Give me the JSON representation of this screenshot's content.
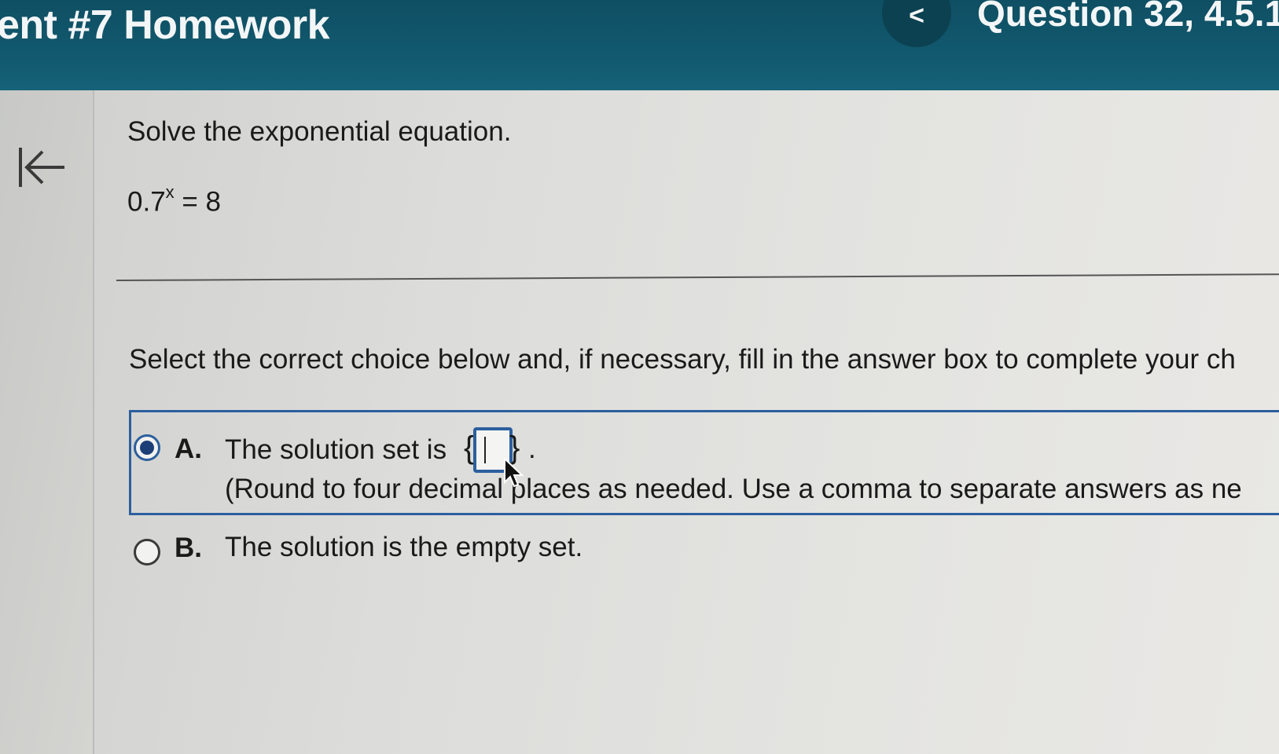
{
  "header": {
    "assignment_title": "ent #7 Homework",
    "prev_button_label": "<",
    "question_title": "Question 32, 4.5.1"
  },
  "question": {
    "prompt": "Solve the exponential equation.",
    "equation_base": "0.7",
    "equation_exponent": "x",
    "equation_rhs": " = 8",
    "instruction": "Select the correct choice below and, if necessary, fill in the answer box to complete your ch"
  },
  "choices": [
    {
      "letter": "A.",
      "text": "The solution set is",
      "brace_open": "{",
      "brace_close": "}",
      "period": ".",
      "answer_value": "",
      "note": "(Round to four decimal places as needed. Use a comma to separate answers as ne",
      "selected": true
    },
    {
      "letter": "B.",
      "text": "The solution is the empty set.",
      "selected": false
    }
  ],
  "icons": {
    "collapse": "collapse-left-icon",
    "cursor": "mouse-pointer-icon"
  },
  "colors": {
    "header_bg": "#125a70",
    "selection_blue": "#2c5f9e"
  }
}
